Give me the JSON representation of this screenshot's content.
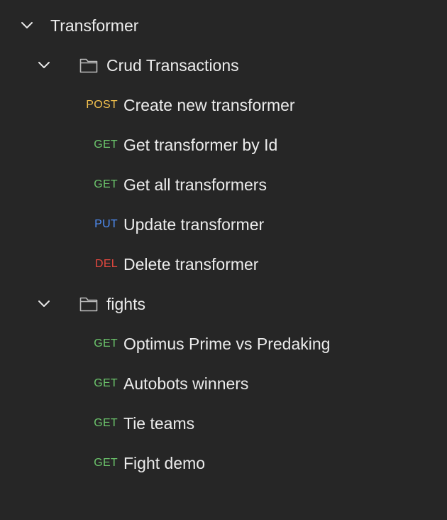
{
  "collection": {
    "name": "Transformer",
    "expanded": true,
    "folders": [
      {
        "name": "Crud Transactions",
        "expanded": true,
        "requests": [
          {
            "method": "POST",
            "name": "Create new transformer"
          },
          {
            "method": "GET",
            "name": "Get transformer by Id"
          },
          {
            "method": "GET",
            "name": "Get all transformers"
          },
          {
            "method": "PUT",
            "name": "Update transformer"
          },
          {
            "method": "DEL",
            "name": "Delete transformer"
          }
        ]
      },
      {
        "name": "fights",
        "expanded": true,
        "requests": [
          {
            "method": "GET",
            "name": "Optimus Prime vs Predaking"
          },
          {
            "method": "GET",
            "name": "Autobots winners"
          },
          {
            "method": "GET",
            "name": "Tie teams"
          },
          {
            "method": "GET",
            "name": "Fight demo"
          }
        ]
      }
    ]
  },
  "method_colors": {
    "POST": "#f2c14e",
    "GET": "#6cc56c",
    "PUT": "#4f8ef7",
    "DEL": "#e5483f"
  },
  "icons": {
    "chevron": "chevron-down-icon",
    "folder": "folder-icon"
  }
}
